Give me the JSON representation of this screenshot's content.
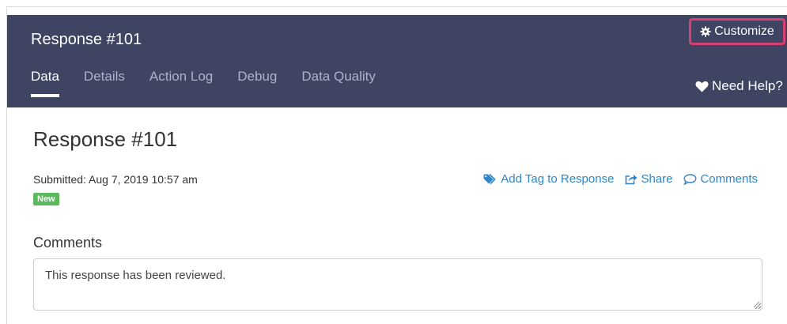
{
  "header": {
    "title": "Response #101",
    "customize_label": "Customize",
    "need_help_label": "Need Help?"
  },
  "tabs": [
    {
      "label": "Data",
      "active": true
    },
    {
      "label": "Details",
      "active": false
    },
    {
      "label": "Action Log",
      "active": false
    },
    {
      "label": "Debug",
      "active": false
    },
    {
      "label": "Data Quality",
      "active": false
    }
  ],
  "main": {
    "title": "Response #101",
    "submitted": "Submitted: Aug 7, 2019 10:57 am",
    "status_badge": "New",
    "actions": {
      "add_tag": "Add Tag to Response",
      "share": "Share",
      "comments": "Comments"
    },
    "comments_label": "Comments",
    "comments_value": "This response has been reviewed."
  },
  "icons": {
    "customize": "gear-icon",
    "need_help": "heart-icon",
    "add_tag": "tags-icon",
    "share": "share-icon",
    "comments": "comment-icon"
  },
  "colors": {
    "header_bg": "#3e4461",
    "highlight": "#d84070",
    "link": "#2f86c8",
    "badge": "#5cb85c"
  }
}
